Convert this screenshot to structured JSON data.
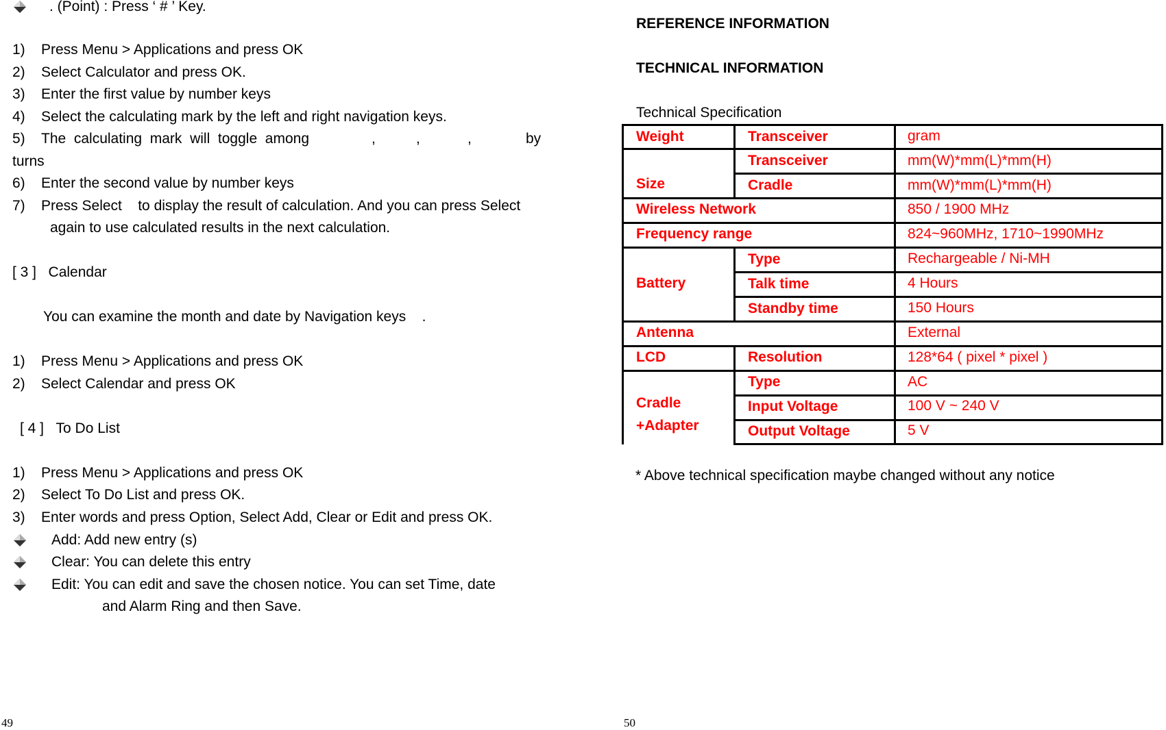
{
  "left_page": {
    "point_note": ". (Point) : Press ‘ # ’ Key.",
    "calculator_steps": [
      {
        "n": "1)",
        "text": "Press Menu > Applications and press OK"
      },
      {
        "n": "2)",
        "text": "Select Calculator and press OK."
      },
      {
        "n": "3)",
        "text": "Enter the first value by number keys"
      },
      {
        "n": "4)",
        "text": "Select the calculating mark by the left and right navigation keys."
      },
      {
        "n": "5)",
        "text": "The  calculating  mark  will  toggle  among",
        "tail_parts": [
          ",",
          ",",
          ",",
          "by"
        ],
        "wrap": "turns"
      },
      {
        "n": "6)",
        "text": "Enter the second value by number keys"
      },
      {
        "n": "7)",
        "text": "Press Select    to display the result of calculation. And you can press Select",
        "wrap": "again to use calculated results in the next calculation."
      }
    ],
    "calendar": {
      "heading_num": "[ 3 ]",
      "heading": "Calendar",
      "intro": "You can examine the month and date by Navigation keys    .",
      "steps": [
        {
          "n": "1)",
          "text": "Press Menu > Applications and press OK"
        },
        {
          "n": "2)",
          "text": "Select Calendar and press OK"
        }
      ]
    },
    "todo": {
      "heading_num": "[ 4 ]",
      "heading": "To Do List",
      "steps": [
        {
          "n": "1)",
          "text": "Press Menu > Applications and press OK"
        },
        {
          "n": "2)",
          "text": "Select To Do List and press OK."
        },
        {
          "n": "3)",
          "text": "Enter words and press Option, Select Add, Clear or Edit and press OK."
        }
      ],
      "bullets": [
        {
          "text": "Add: Add new entry (s)"
        },
        {
          "text": "Clear: You can delete this entry"
        },
        {
          "text": "Edit: You can edit and save the chosen notice. You can set Time, date",
          "wrap": "and Alarm Ring and then Save."
        }
      ]
    },
    "page_number": "49"
  },
  "right_page": {
    "heading1": "REFERENCE INFORMATION",
    "heading2": "TECHNICAL INFORMATION",
    "caption": "Technical Specification",
    "table": {
      "rows": [
        {
          "group": "Weight",
          "item": "Transceiver",
          "value": "gram"
        },
        {
          "group": "Size",
          "item": "Transceiver",
          "value": "mm(W)*mm(L)*mm(H)"
        },
        {
          "group": "Size",
          "item": "Cradle",
          "value": "mm(W)*mm(L)*mm(H)"
        },
        {
          "group": "Wireless Network",
          "item": "",
          "value": "850 / 1900 MHz"
        },
        {
          "group": "Frequency range",
          "item": "",
          "value": "824~960MHz, 1710~1990MHz"
        },
        {
          "group": "Battery",
          "item": "Type",
          "value": "Rechargeable / Ni-MH"
        },
        {
          "group": "Battery",
          "item": "Talk time",
          "value": "4 Hours"
        },
        {
          "group": "Battery",
          "item": "Standby time",
          "value": "150 Hours"
        },
        {
          "group": "Antenna",
          "item": "",
          "value": "External"
        },
        {
          "group": "LCD",
          "item": "Resolution",
          "value": "128*64 ( pixel * pixel )"
        },
        {
          "group": "Cradle +Adapter",
          "item": "Type",
          "value": "AC"
        },
        {
          "group": "Cradle +Adapter",
          "item": "Input Voltage",
          "value": "100 V ~ 240 V"
        },
        {
          "group": "Cradle +Adapter",
          "item": "Output Voltage",
          "value": "5 V"
        }
      ],
      "group_labels": {
        "weight": "Weight",
        "size": "Size",
        "wireless": "Wireless Network",
        "frequency": "Frequency range",
        "battery": "Battery",
        "antenna": "Antenna",
        "lcd": "LCD",
        "cradle_line1": "Cradle",
        "cradle_line2": "+Adapter"
      },
      "text_color": "#ff0000"
    },
    "footnote": "* Above technical specification maybe changed without any notice",
    "page_number": "50"
  }
}
